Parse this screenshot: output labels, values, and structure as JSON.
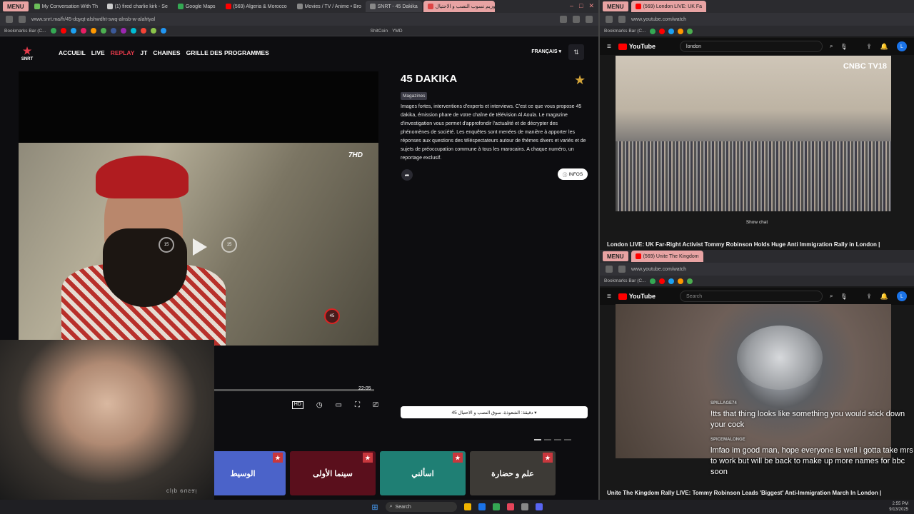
{
  "left_browser": {
    "menu_label": "MENU",
    "tabs": [
      {
        "label": "My Conversation With Th",
        "color": "#6bbf59"
      },
      {
        "label": "(1) fired charlie kirk - Se",
        "color": "#cccccc"
      },
      {
        "label": "Google Maps",
        "color": "#34a853"
      },
      {
        "label": "(569) Algeria & Morocco",
        "color": "#ff0000"
      },
      {
        "label": "Movies / TV / Anime • Bro",
        "color": "#888888"
      },
      {
        "label": "SNRT - 45 Dakika",
        "color": "#888888"
      },
      {
        "label": "دوزيم نسوب النصب و الاحتيال",
        "color": "#d44"
      }
    ],
    "address": "www.snrt.ma/fr/45-dqyqt-alshwdht-swq-alnsb-w-alahtyal",
    "bookmarks": [
      "Bookmarks Bar (C...",
      "ShitCoin",
      "YMD"
    ],
    "win_ctrls": [
      "–",
      "□",
      "✕"
    ]
  },
  "snrt": {
    "logo_text": "SNRT",
    "nav": [
      "ACCUEIL",
      "LIVE",
      "REPLAY",
      "JT",
      "CHAINES",
      "GRILLE DES PROGRAMMES"
    ],
    "active_nav": "REPLAY",
    "language": "FRANÇAIS ▾",
    "lang_icon": "⇅",
    "hd_logo": "7HD",
    "skip_back": "15",
    "skip_fwd": "15",
    "badge": "45",
    "progress_time": "22:05",
    "progress_fraction": 0.4,
    "controls": {
      "play": "▶",
      "rewind": "↺",
      "forward": "↻",
      "hd": "HD",
      "speed": "◷",
      "pip": "▭",
      "fullscreen": "⛶",
      "cast": "⎚"
    },
    "show_title": "45 DAKIKA",
    "genre": "Magazines",
    "favorite_icon": "★",
    "description": "Images fortes, interventions d'experts et interviews. C'est ce que vous propose 45 dakika, émission phare de votre chaîne de télévision Al Aoula. Le magazine d'investigation vous permet d'approfondir l'actualité et de décrypter des phénomènes de société. Les enquêtes sont menées de manière à apporter les réponses aux questions des téléspectateurs autour de thèmes divers et variés et de sujets de préoccupation commune à tous les marocains. A chaque numéro, un reportage exclusif.",
    "share_icon": "➦",
    "infos_label": "INFOS",
    "infos_icon": "ⓘ",
    "episode_label": "45 دقيقة: الشعوذة، سوق النصب و الاحتيال ▾",
    "carousel": [
      {
        "title": "الوسيط",
        "color": "#4b63c9"
      },
      {
        "title": "سينما الأولى",
        "color": "#5a0f1c"
      },
      {
        "title": "اسألني",
        "color": "#1f7f74"
      },
      {
        "title": "علم و حضارة",
        "color": "#3d3a36"
      }
    ],
    "card_star": "★",
    "webcam_caption": "ᴉɐsnǝ dᴉlɔ"
  },
  "rb_top": {
    "menu_label": "MENU",
    "tab_label": "(569) London LIVE: UK Fa",
    "address": "www.youtube.com/watch",
    "bookmarks_label": "Bookmarks Bar (C...",
    "yt_logo": "YouTube",
    "search_value": "london",
    "overlay_logo": "CNBC TV18",
    "show_chat": "Show chat",
    "title": "London LIVE: UK Far-Right Activist Tommy Robinson Holds Huge Anti Immigration Rally in London |"
  },
  "rb_bot": {
    "menu_label": "MENU",
    "tab_label": "(569) Unite The Kingdom",
    "address": "www.youtube.com/watch",
    "bookmarks_label": "Bookmarks Bar (C...",
    "yt_logo": "YouTube",
    "search_placeholder": "Search",
    "chat": [
      {
        "name": "SPILLAGE74",
        "msg": "!tts that thing looks like something you would stick down your cock"
      },
      {
        "name": "SPICEMALONGE",
        "msg": "lmfao im good man, hope everyone is well i gotta take mrs to work but will be back to make up more names for bbc soon"
      }
    ],
    "title": "Unite The Kingdom Rally LIVE: Tommy Robinson Leads 'Biggest' Anti-Immigration March In London |"
  },
  "taskbar": {
    "search_label": "Search",
    "search_icon": "⌕",
    "start_icon": "⊞",
    "clock": "2:55 PM",
    "date": "9/13/2025"
  },
  "colors": {
    "accent": "#e53a4a",
    "gold": "#d4a53a"
  }
}
